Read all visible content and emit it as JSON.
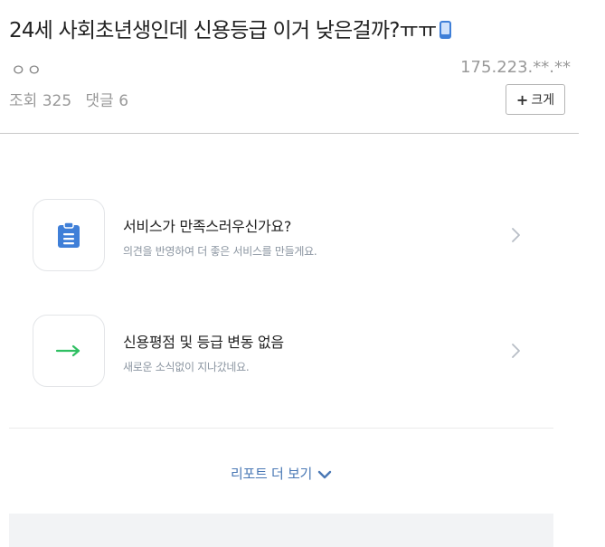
{
  "post": {
    "title": "24세 사회초년생인데 신용등급 이거 낮은걸까?ㅠㅠ",
    "author": "ㅇㅇ",
    "ip": "175.223.**.**",
    "views_label": "조회",
    "views": "325",
    "comments_label": "댓글",
    "comments": "6",
    "enlarge_label": "크게"
  },
  "cards": [
    {
      "icon": "clipboard-icon",
      "title": "서비스가 만족스러우신가요?",
      "subtitle": "의견을 반영하여 더 좋은 서비스를 만들게요."
    },
    {
      "icon": "arrow-right-icon",
      "title": "신용평점 및 등급 변동 없음",
      "subtitle": "새로운 소식없이 지나갔네요."
    }
  ],
  "more": {
    "label": "리포트 더 보기"
  },
  "colors": {
    "accent_blue": "#3f7fd8",
    "green": "#2fbf62",
    "link": "#4a78b5"
  }
}
